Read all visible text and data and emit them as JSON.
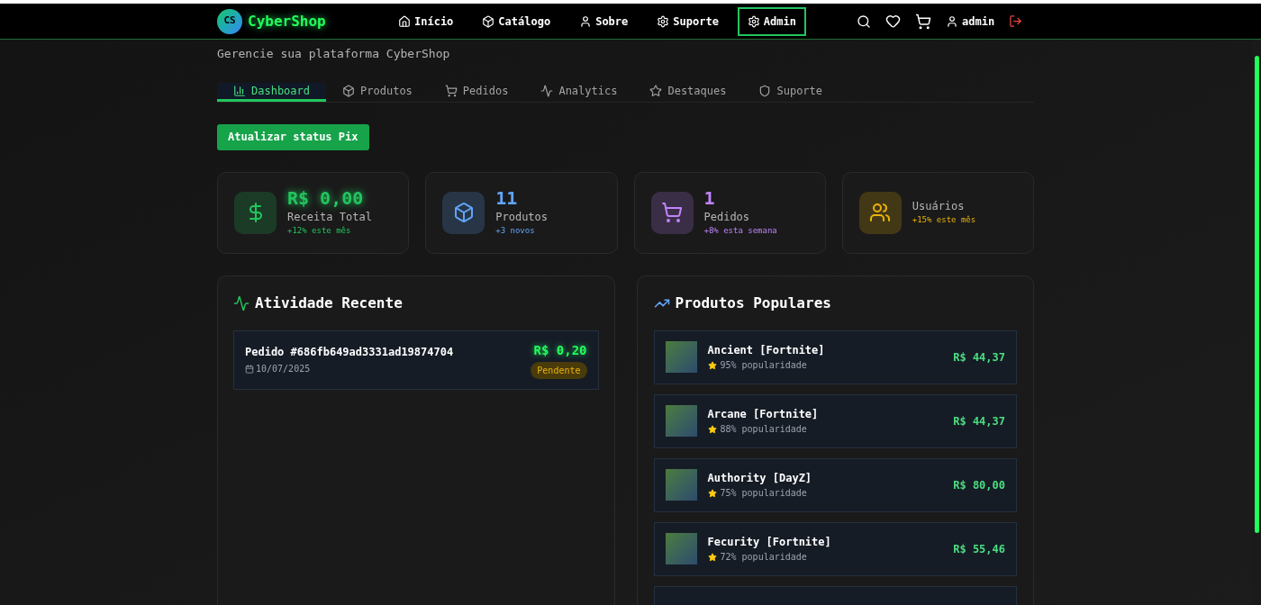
{
  "header": {
    "logo_badge": "CS",
    "logo_text": "CyberShop",
    "nav": [
      {
        "label": "Início",
        "kind": "home",
        "selected": false
      },
      {
        "label": "Catálogo",
        "kind": "box",
        "selected": false
      },
      {
        "label": "Sobre",
        "kind": "user",
        "selected": false
      },
      {
        "label": "Suporte",
        "kind": "gear",
        "selected": false
      },
      {
        "label": "Admin",
        "kind": "gear",
        "selected": true
      }
    ],
    "user": "admin"
  },
  "subtitle": "Gerencie sua plataforma CyberShop",
  "tabs": [
    {
      "label": "Dashboard",
      "kind": "chart",
      "selected": true
    },
    {
      "label": "Produtos",
      "kind": "box",
      "selected": false
    },
    {
      "label": "Pedidos",
      "kind": "cart",
      "selected": false
    },
    {
      "label": "Analytics",
      "kind": "pulse",
      "selected": false
    },
    {
      "label": "Destaques",
      "kind": "star",
      "selected": false
    },
    {
      "label": "Suporte",
      "kind": "shield",
      "selected": false
    }
  ],
  "action_button": "Atualizar status Pix",
  "stats": [
    {
      "kind": "dollar",
      "value": "R$ 0,00",
      "label": "Receita Total",
      "change": "+12% este mês",
      "color": "#22c55e"
    },
    {
      "kind": "box",
      "value": "11",
      "label": "Produtos",
      "change": "+3 novos",
      "color": "#60a5fa"
    },
    {
      "kind": "cart",
      "value": "1",
      "label": "Pedidos",
      "change": "+8% esta semana",
      "color": "#c084fc"
    },
    {
      "kind": "users",
      "label": "Usuários",
      "change": "+15% este mês",
      "color": "#eab308"
    }
  ],
  "recent_activity": {
    "title": "Atividade Recente",
    "items": [
      {
        "order": "Pedido #686fb649ad3331ad19874704",
        "date": "10/07/2025",
        "amount": "R$ 0,20",
        "status": "Pendente"
      }
    ]
  },
  "popular_products": {
    "title": "Produtos Populares",
    "items": [
      {
        "name": "Ancient [Fortnite]",
        "popularity": "95% popularidade",
        "price": "R$ 44,37"
      },
      {
        "name": "Arcane [Fortnite]",
        "popularity": "88% popularidade",
        "price": "R$ 44,37"
      },
      {
        "name": "Authority [DayZ]",
        "popularity": "75% popularidade",
        "price": "R$ 80,00"
      },
      {
        "name": "Fecurity [Fortnite]",
        "popularity": "72% popularidade",
        "price": "R$ 55,46"
      }
    ]
  }
}
